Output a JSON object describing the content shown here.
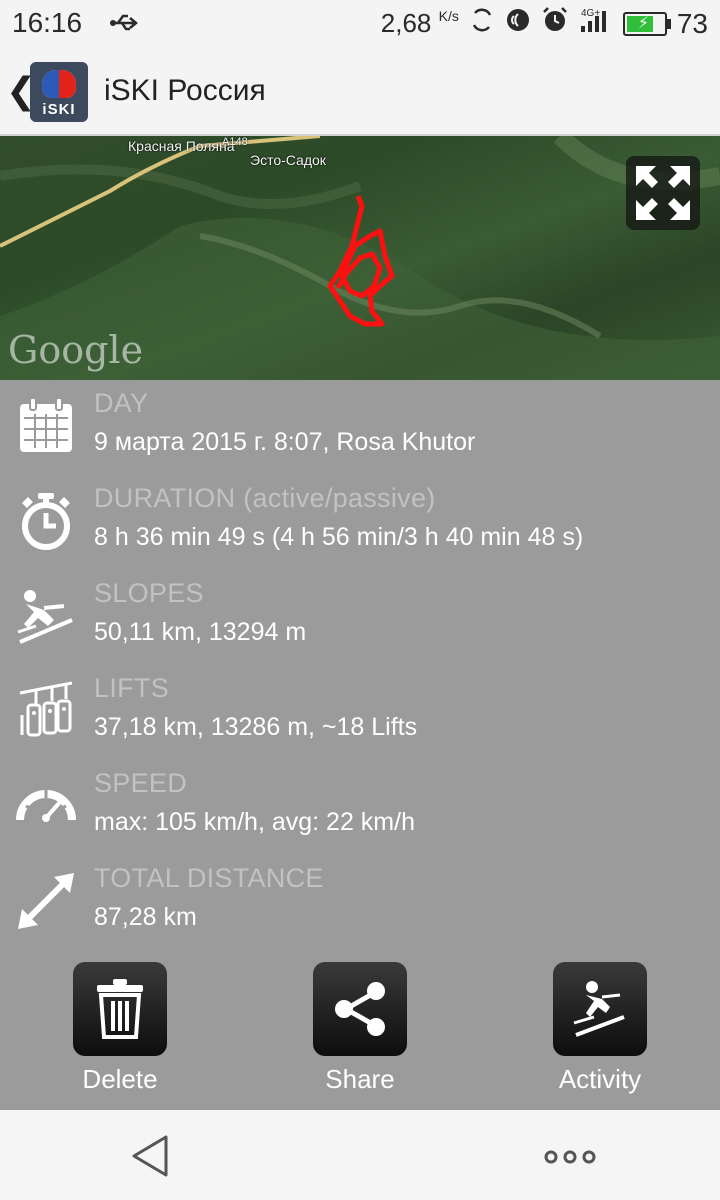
{
  "status": {
    "time": "16:16",
    "net_speed": "2,68",
    "net_speed_unit": "K/s",
    "signal_label": "4G+",
    "battery_percent": "73",
    "battery_level": 0.73
  },
  "app": {
    "title": "iSKI Россия",
    "logo_text": "iSKI"
  },
  "map": {
    "labels": [
      "Красная Поляна",
      "Эсто-Садок",
      "А148"
    ],
    "attribution": "Google"
  },
  "stats": [
    {
      "label": "DAY",
      "value": "9 марта 2015 г. 8:07, Rosa Khutor",
      "icon": "calendar-icon"
    },
    {
      "label": "DURATION (active/passive)",
      "value": "8 h 36 min 49 s (4 h 56 min/3 h 40 min 48 s)",
      "icon": "stopwatch-icon"
    },
    {
      "label": "SLOPES",
      "value": "50,11 km, 13294 m",
      "icon": "skier-icon"
    },
    {
      "label": "LIFTS",
      "value": "37,18 km, 13286 m, ~18 Lifts",
      "icon": "chairlift-icon"
    },
    {
      "label": "SPEED",
      "value": "max: 105 km/h, avg: 22 km/h",
      "icon": "speedometer-icon"
    },
    {
      "label": "TOTAL DISTANCE",
      "value": "87,28 km",
      "icon": "distance-arrow-icon"
    }
  ],
  "actions": {
    "delete": "Delete",
    "share": "Share",
    "activity": "Activity"
  }
}
